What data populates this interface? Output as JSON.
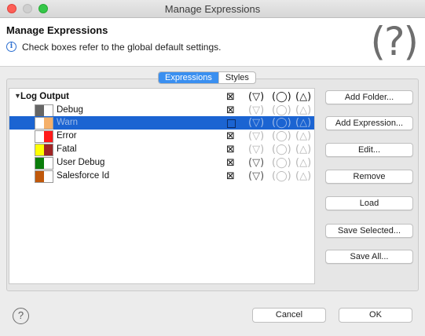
{
  "window": {
    "title": "Manage Expressions",
    "buttons": [
      "close",
      "minimize",
      "maximize"
    ]
  },
  "header": {
    "title": "Manage Expressions",
    "info_icon": "info-icon",
    "message": "Check boxes refer to the global default settings.",
    "help_glyph": "(?)"
  },
  "tabs": [
    {
      "label": "Expressions",
      "selected": true
    },
    {
      "label": "Styles",
      "selected": false
    }
  ],
  "tree": {
    "root_label": "Log Output",
    "column_icons": [
      "enable-icon",
      "filter-icon",
      "circle-icon",
      "triangle-icon"
    ],
    "column_glyphs": [
      "⊠",
      "(▽)",
      "(◯)",
      "(△)"
    ],
    "rows": [
      {
        "label": "Debug",
        "fg": "#666666",
        "bg": "#ffffff",
        "selected": false
      },
      {
        "label": "Warn",
        "fg": "#ffffff",
        "bg": "#f5b06a",
        "selected": true
      },
      {
        "label": "Error",
        "fg": "#ffffff",
        "bg": "#ff1a1a",
        "selected": false
      },
      {
        "label": "Fatal",
        "fg": "#ffff00",
        "bg": "#a02525",
        "selected": false
      },
      {
        "label": "User Debug",
        "fg": "#0a7d0a",
        "bg": "#ffffff",
        "selected": false
      },
      {
        "label": "Salesforce Id",
        "fg": "#c0580a",
        "bg": "#ffffff",
        "selected": false
      }
    ]
  },
  "side_buttons": {
    "add_folder": "Add Folder...",
    "add_expression": "Add Expression...",
    "edit": "Edit...",
    "remove": "Remove",
    "load": "Load",
    "save_selected": "Save Selected...",
    "save_all": "Save All..."
  },
  "footer": {
    "help_glyph": "?",
    "cancel": "Cancel",
    "ok": "OK"
  }
}
